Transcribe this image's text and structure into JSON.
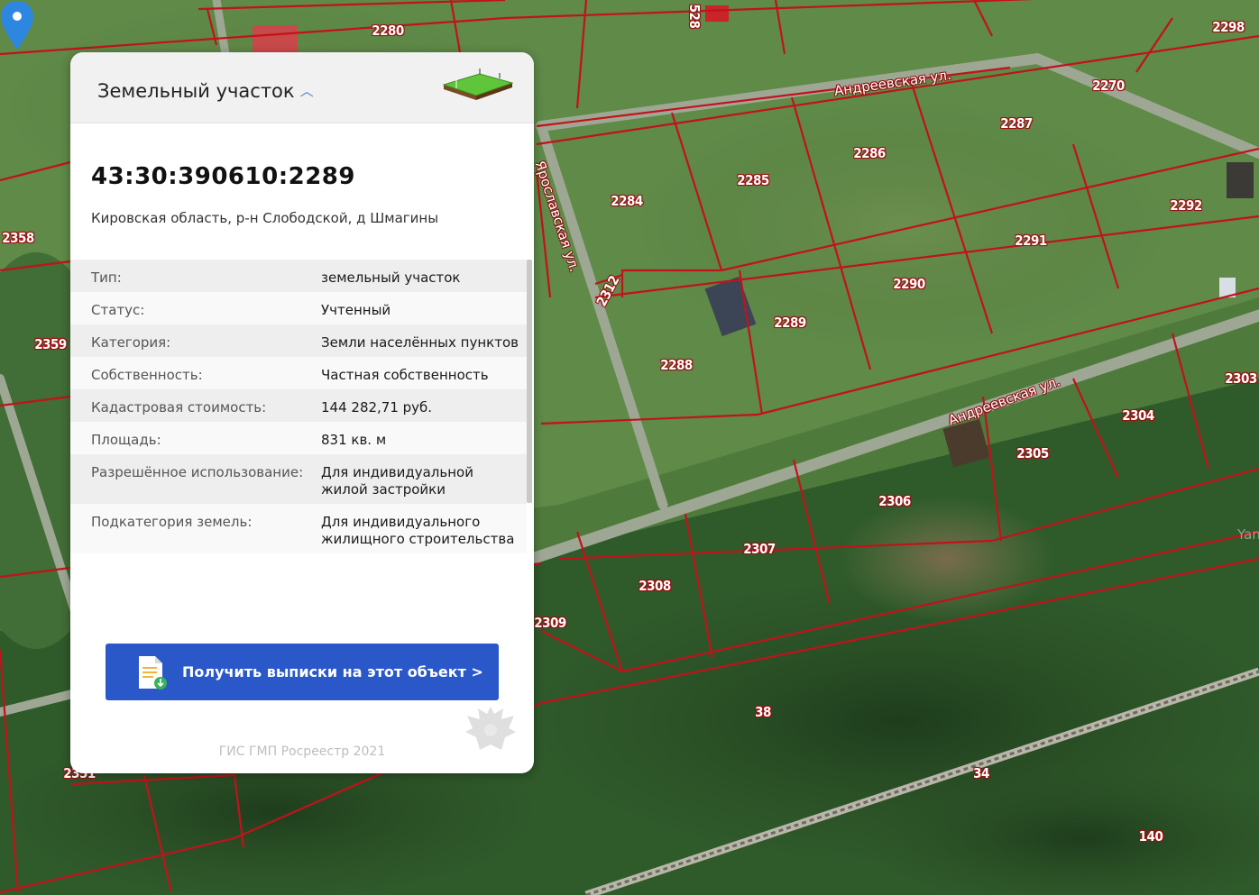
{
  "map": {
    "plot_numbers": [
      "2280",
      "2270",
      "2298",
      "2287",
      "2286",
      "2285",
      "2284",
      "2292",
      "2291",
      "2290",
      "2312",
      "2358",
      "2359",
      "2288",
      "2289",
      "2303",
      "2304",
      "2305",
      "2306",
      "2307",
      "2308",
      "2309",
      "38",
      "34",
      "140",
      "2351",
      "528"
    ],
    "streets": [
      "Андреевская ул.",
      "Ярославская ул.",
      "Андреевская ул."
    ],
    "watermark_text": "Yandex"
  },
  "card": {
    "title": "Земельный участок",
    "cad_number": "43:30:390610:2289",
    "address": "Кировская область, р-н Слободской, д Шмагины",
    "properties": [
      {
        "key": "Тип:",
        "value": "земельный участок"
      },
      {
        "key": "Статус:",
        "value": "Учтенный"
      },
      {
        "key": "Категория:",
        "value": "Земли населённых пунктов"
      },
      {
        "key": "Собственность:",
        "value": "Частная собственность"
      },
      {
        "key": "Кадастровая стоимость:",
        "value": "144 282,71 руб."
      },
      {
        "key": "Площадь:",
        "value": "831 кв. м"
      },
      {
        "key": "Разрешённое использование:",
        "value": "Для индивидуальной жилой застройки"
      },
      {
        "key": "Подкатегория земель:",
        "value": "Для индивидуального жилищного строительства"
      }
    ],
    "button_label": "Получить выписки на этот объект >",
    "footer": "ГИС ГМП Росреестр 2021"
  },
  "colors": {
    "button": "#2b58c9",
    "boundary": "#c2121b",
    "marker": "#2d86e0"
  },
  "icons": [
    "chevron-up-icon",
    "land-plot-icon",
    "document-download-icon",
    "eagle-emblem-icon",
    "map-marker-icon"
  ]
}
